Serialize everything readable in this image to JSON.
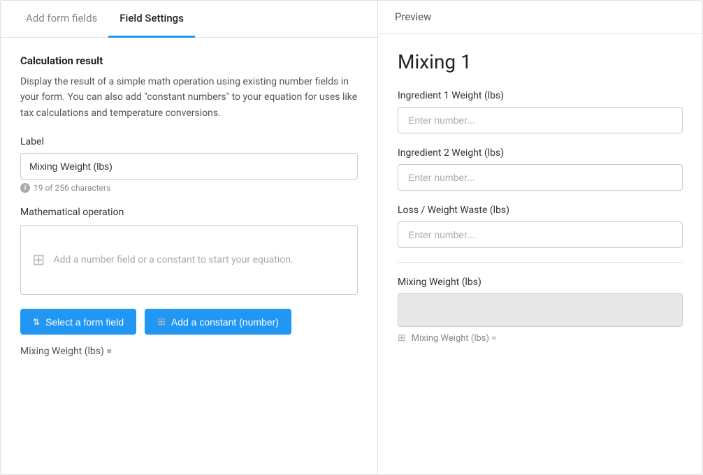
{
  "tabs": {
    "tab1": {
      "label": "Add form fields",
      "active": false
    },
    "tab2": {
      "label": "Field Settings",
      "active": true
    }
  },
  "left": {
    "section_title": "Calculation result",
    "section_desc": "Display the result of a simple math operation using existing number fields in your form. You can also add \"constant numbers\" to your equation for uses like tax calculations and temperature conversions.",
    "label_text": "Label",
    "label_input_value": "Mixing Weight (lbs)",
    "char_count": "19 of 256 characters",
    "math_op_label": "Mathematical operation",
    "equation_placeholder": "Add a number field or a constant to start your equation.",
    "btn1_label": "Select a form field",
    "btn2_label": "Add a constant (number)",
    "formula_text": "Mixing Weight (lbs) ="
  },
  "right": {
    "preview_label": "Preview",
    "form_title": "Mixing 1",
    "fields": [
      {
        "label": "Ingredient 1 Weight (lbs)",
        "placeholder": "Enter number..."
      },
      {
        "label": "Ingredient 2 Weight (lbs)",
        "placeholder": "Enter number..."
      },
      {
        "label": "Loss / Weight Waste (lbs)",
        "placeholder": "Enter number..."
      }
    ],
    "calc_field_label": "Mixing Weight (lbs)",
    "calc_result_formula": "Mixing Weight (lbs) ="
  },
  "icons": {
    "info": "i",
    "grid": "⊞",
    "arrows": "⇅"
  }
}
